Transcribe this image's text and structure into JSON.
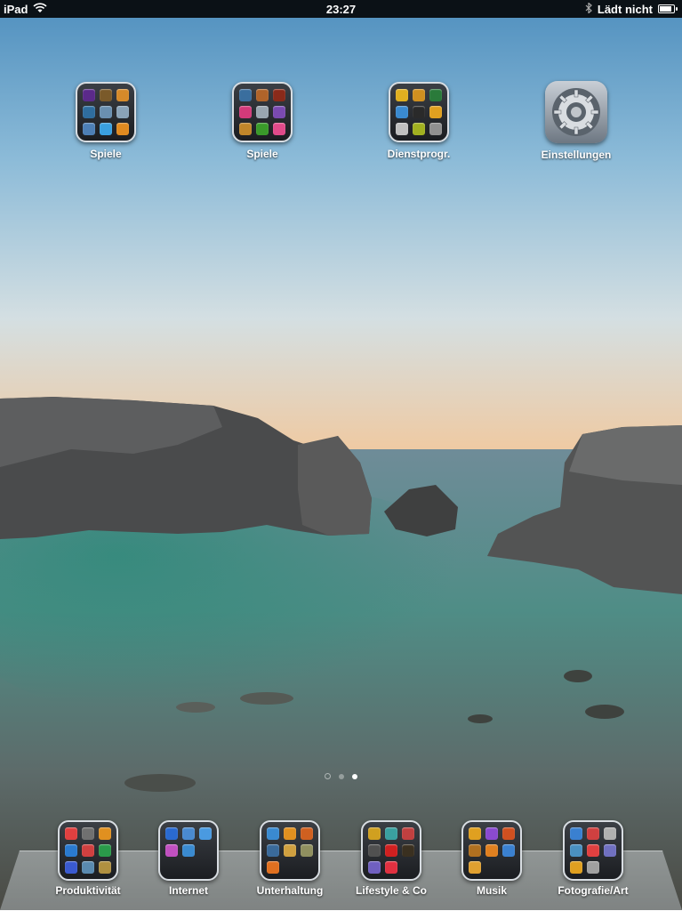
{
  "status_bar": {
    "device": "iPad",
    "time": "23:27",
    "charge_text": "Lädt nicht",
    "battery_level": 0.9
  },
  "home": {
    "folders": [
      {
        "label": "Spiele",
        "colors": [
          "#5b2a8a",
          "#7a5a2a",
          "#d68a2a",
          "#2f6d9e",
          "#6a8fb0",
          "#8aa3b8",
          "#4d7fb5",
          "#3aa0e0",
          "#e08a20"
        ]
      },
      {
        "label": "Spiele",
        "colors": [
          "#3a6e9e",
          "#b0642a",
          "#8a2a1a",
          "#d23a7a",
          "#9aa6b0",
          "#7a4ab0",
          "#c0862a",
          "#3a9a2a",
          "#e04a8a"
        ]
      },
      {
        "label": "Dienstprogr.",
        "colors": [
          "#e0b020",
          "#d09020",
          "#2a7a3a",
          "#3a8ad0",
          "#2a2a2a",
          "#e0a020",
          "#c0c0c0",
          "#a0b020",
          "#909090"
        ]
      }
    ],
    "settings": {
      "label": "Einstellungen",
      "icon": "gear-icon"
    }
  },
  "page_indicator": {
    "pages": 2,
    "current": 2
  },
  "dock": {
    "folders": [
      {
        "label": "Produktivität",
        "colors": [
          "#e04040",
          "#707070",
          "#e09020",
          "#2a7ad0",
          "#d04040",
          "#2a9a4a",
          "#3a5ad0",
          "#5a8ab0",
          "#b09040"
        ]
      },
      {
        "label": "Internet",
        "colors": [
          "#2a6ad0",
          "#4a8ad0",
          "#4a9ae0",
          "#c050c0",
          "#3a8ad0"
        ]
      },
      {
        "label": "Unterhaltung",
        "colors": [
          "#3a8ad0",
          "#e09020",
          "#d06020",
          "#3a6a9a",
          "#d0a040",
          "#909060",
          "#e07020"
        ]
      },
      {
        "label": "Lifestyle & Co",
        "colors": [
          "#d0a020",
          "#3aa0a0",
          "#c04040",
          "#505050",
          "#d02020",
          "#3a3020",
          "#7060c0",
          "#e03040"
        ]
      },
      {
        "label": "Musik",
        "colors": [
          "#e0a020",
          "#8a4ad0",
          "#d05020",
          "#b07020",
          "#e08020",
          "#3a80d0",
          "#e0a030"
        ]
      },
      {
        "label": "Fotografie/Art",
        "colors": [
          "#3a80d0",
          "#d04040",
          "#b0b0b0",
          "#4a90c0",
          "#e04040",
          "#7070c0",
          "#e0a020",
          "#a0a0a0"
        ]
      }
    ]
  }
}
